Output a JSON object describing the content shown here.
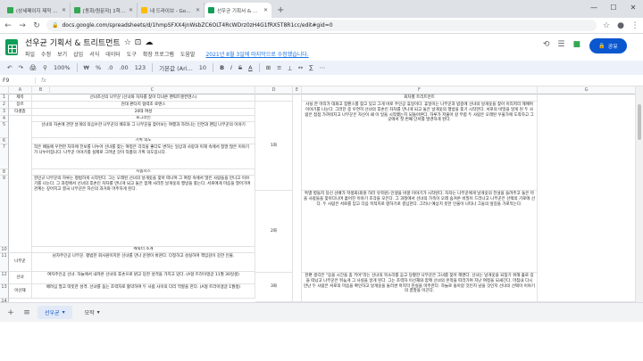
{
  "browser": {
    "tabs": [
      {
        "title": "(상세페이지 제작 이미지 - Goog",
        "color": "#34a853"
      },
      {
        "title": "[동화/원문자] 1학년 녹화강의 학습",
        "color": "#34a853"
      },
      {
        "title": "내 드라이브 - Google Drive",
        "color": "#fbbc04"
      },
      {
        "title": "선우균 기획서 & 트리트먼트 - G",
        "color": "#0f9d58"
      }
    ],
    "new_tab": "+",
    "url": "docs.google.com/spreadsheets/d/1hmpSFXX4jnWsbZC6OLT4RcWDrz0zH4G1fRX5T8R1cc/edit#gid=0"
  },
  "app": {
    "title": "선우균 기획서 & 트리트먼트",
    "title_icons": [
      "☆",
      "⊡",
      "☁"
    ],
    "menus": [
      "파일",
      "수정",
      "보기",
      "삽입",
      "서식",
      "데이터",
      "도구",
      "확장 프로그램",
      "도움말"
    ],
    "last_edit": "2021년 8월 3일에 마지막으로 수정했습니다.",
    "share_label": "공유",
    "share_icon": "🔒"
  },
  "toolbar": {
    "items": [
      "↶",
      "↷",
      "🖨",
      "⚲",
      "100%",
      "₩",
      "%",
      ".0",
      ".00",
      "123",
      "기본값 (Ari...",
      "10",
      "B",
      "I",
      "S",
      "A",
      "⊞",
      "≡",
      "⟂",
      "↔",
      "∑",
      "⋯"
    ]
  },
  "formula_bar": {
    "ref": "F9",
    "fx": "fx"
  },
  "columns": [
    "A",
    "B",
    "C",
    "D",
    "E",
    "F",
    "G"
  ],
  "rows": {
    "r1": [
      "1",
      "제목",
      "선녀조선의 나무꾼 (선녀와 차차를 찾아 다녀온 팬픽트렌컨텐스)",
      "회차별 트리트먼트"
    ],
    "r2": [
      "2",
      "장르",
      "현대 판타지 협력조 로맨스"
    ],
    "r3": [
      "3",
      "타겟층",
      "20대 여성"
    ],
    "r4": [
      "4",
      "",
      "로그라인"
    ],
    "r5": [
      "5",
      "",
      "선녀의 자손에 관한 날개의 의심수한 나무꾼의 배호와 그 나무꾼을 찾아보는 여행과 자라나는 인연과 팬덤 나무꾼의 이야기",
      "1화"
    ],
    "r6": [
      "6",
      "",
      "기획 의도"
    ],
    "r7": [
      "7",
      "",
      "작은 배들에 우연한 차차에 전보를 나누어 선녀를 찾는 여정은 각각을 좋다도 변하는 일상과 사랑과 이해 속에서 정말 많은 이야기가 나누어집니다. 나무꾼 이야기를 실제로 그려낸 것이 작품의 기획 의도입니다."
    ],
    "r8": [
      "8",
      "",
      "시놉시스"
    ],
    "r9": [
      "9",
      "",
      "현민규 나무꾼의 하루는 평범하게 시작된다. 그는 오래된 선녀의 날개옷을 찾아 떠나며 그 여정 속에서 많은 사람들을 만나고 이야기를 나눈다. 그 과정에서 선녀의 후손인 차차를 만나게 되고 둘은 함께 사라진 날개옷의 행방을 쫓는다. 서로에게 마음을 열어가며 관계는 깊어지고 결국 나무꾼은 자신의 과거와 마주하게 된다.",
      "2화"
    ],
    "r10": [
      "10",
      "",
      "캐릭터 소개"
    ],
    "r11": [
      "11",
      "나무꾼",
      "남자주인공 나무꾼. 평범한 회사원이지만 선녀를 만나 운명이 바뀐다. 다정하고 성실하며 책임감이 강한 인물.",
      "3화"
    ],
    "r12": [
      "12",
      "선녀",
      "여자주인공 선녀. 하늘에서 내려온 선녀의 후손으로 밝고 당찬 성격을 가지고 있다. (A형 트라이앵글 11월 30일생)"
    ],
    "r13": [
      "13",
      "이선재",
      "배려심 많고 따뜻한 성격. 선녀를 돕는 조력자로 활약하며 두 사람 사이의 다리 역할을 한다. (A형 트라이앵글 1월생)"
    ],
    "r14": [
      "14",
      ""
    ],
    "ep1": "사실 한 마리가 대화고 침팬스를 찾고 있고 그게 바로 주인공 휴일이다. 휴일이는 나무꾼과 밤중에 선녀의 날개옷을 찾아 이리저리 헤매며 이야기를 나눈다. 그러던 중 우연히 선녀의 후손인 차차를 만나게 되고 둘은 날개옷의 행방을 쫓기 시작한다. 서로의 비밀을 알게 된 두 사람은 점점 가까워지고 나무꾼은 자신이 왜 이 일을 시작했는지 되돌아본다. 하루가 저물어 갈 무렵 두 사람은 오래된 우물가에 도착하고 그곳에서 첫 번째 단서를 발견하게 된다.",
    "ep2": "특별 병들지 당신 선배가 학생회(회원 하러 유학원) 인생을 바꿀 이야기가 시작된다. 차차는 나무꾼에게 날개옷의 전설을 들려주고 둘은 마을 사람들을 찾아다니며 흩어진 이야기 조각을 모은다. 그 과정에서 선녀의 가족이 오래 숨겨온 비밀이 드러나고 나무꾼은 선택의 기로에 선다. 두 사람은 서로를 믿고 다음 목적지로 향하기로 결심한다. 그러나 예상치 못한 인물이 나타나 그들의 앞길을 가로막는다.",
    "ep3": "한편 생각은 \"응을 시간을 좀 키어\"라는 선녀의 목소리를 듣고 당황한 나무꾼은 그녀를 찾아 헤맨다. 선녀는 날개옷을 되찾기 위해 홀로 길을 떠났고 나무꾼은 뒤늦게 그 사실을 알게 된다. 그는 조력자 이선재와 함께 선녀의 흔적을 따라가며 지난 여정을 되새긴다. 마침내 다시 만난 두 사람은 서로의 마음을 확인하고 날개옷을 둘러싼 마지막 진실을 마주한다. 하늘로 돌아갈 것인지 남을 것인지 선녀의 선택이 이야기의 결말을 이끈다."
  },
  "row15": "15",
  "sheets": {
    "add": "+",
    "list": "≡",
    "tabs": [
      "선우균",
      "모작"
    ]
  }
}
